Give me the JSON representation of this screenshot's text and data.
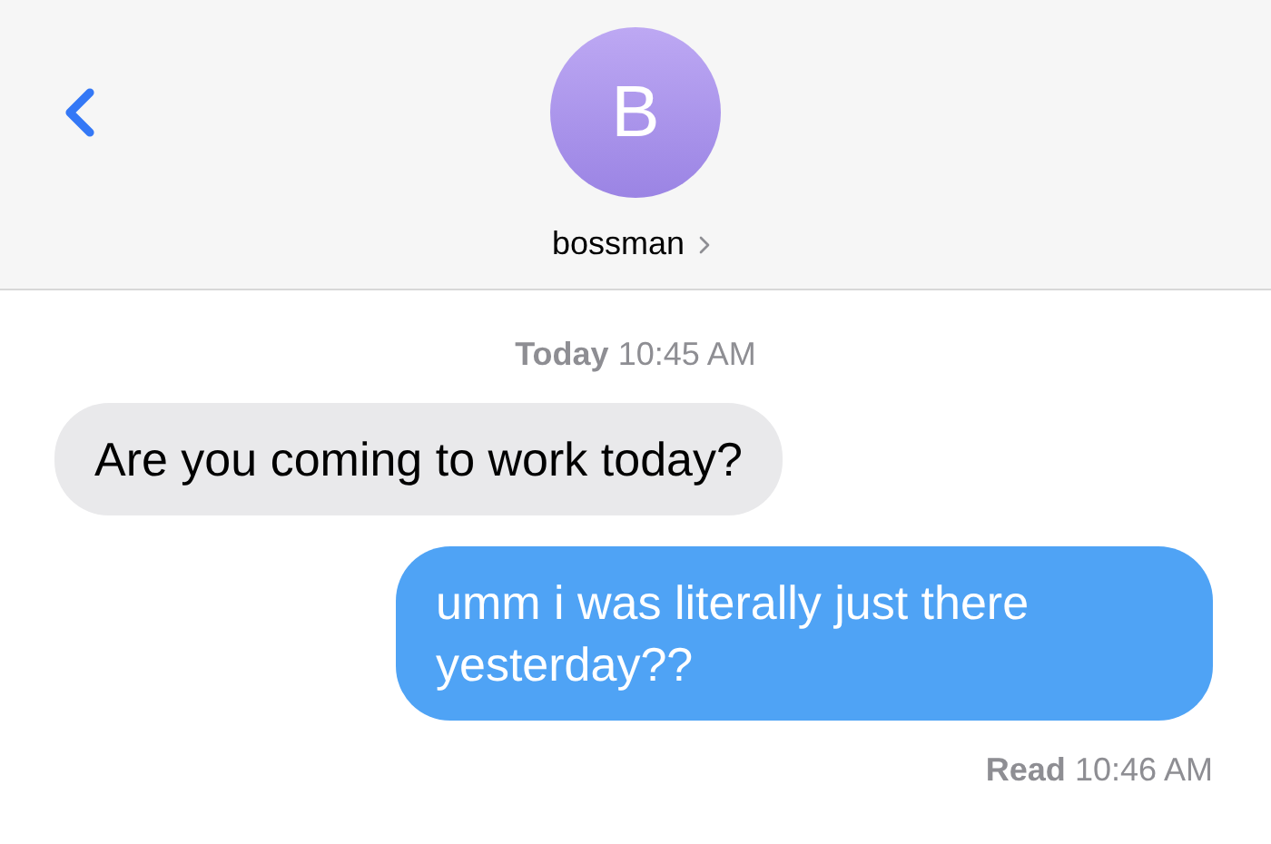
{
  "header": {
    "avatar_letter": "B",
    "contact_name": "bossman"
  },
  "timestamp": {
    "day": "Today",
    "time": "10:45 AM"
  },
  "messages": [
    {
      "kind": "incoming",
      "text": "Are you coming to work today?"
    },
    {
      "kind": "outgoing",
      "text": "umm i was literally just there yesterday??"
    }
  ],
  "receipt": {
    "label": "Read",
    "time": "10:46 AM"
  }
}
